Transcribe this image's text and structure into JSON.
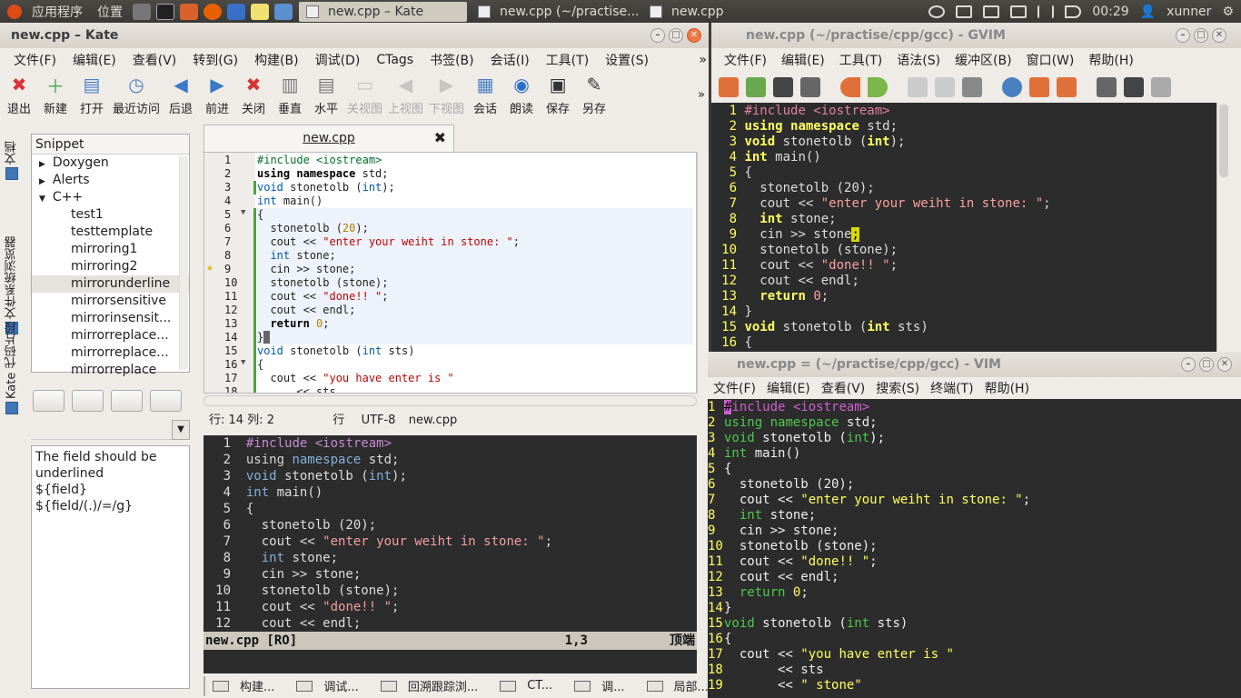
{
  "panel": {
    "apps_menu": "应用程序",
    "places_menu": "位置",
    "tasks": [
      {
        "label": "new.cpp – Kate",
        "active": true
      },
      {
        "label": "new.cpp (~/practise...",
        "active": false
      },
      {
        "label": "new.cpp",
        "active": false
      }
    ],
    "clock": "00:29",
    "user": "xunner"
  },
  "kate": {
    "title": "new.cpp – Kate",
    "menu": [
      "文件(F)",
      "编辑(E)",
      "查看(V)",
      "转到(G)",
      "构建(B)",
      "调试(D)",
      "CTags",
      "书签(B)",
      "会话(I)",
      "工具(T)",
      "设置(S)"
    ],
    "toolbar": [
      {
        "label": "退出",
        "icon": "quit-icon",
        "color": "#d93434",
        "glyph": "✖",
        "disabled": false
      },
      {
        "label": "新建",
        "icon": "new-file-icon",
        "color": "#4aa64a",
        "glyph": "＋",
        "disabled": false
      },
      {
        "label": "打开",
        "icon": "open-icon",
        "color": "#4a7fc2",
        "glyph": "▤",
        "disabled": false
      },
      {
        "label": "最近访问",
        "icon": "recent-icon",
        "color": "#4a7fc2",
        "glyph": "◷",
        "disabled": false
      },
      {
        "label": "后退",
        "icon": "back-icon",
        "color": "#3a78c8",
        "glyph": "◀",
        "disabled": false
      },
      {
        "label": "前进",
        "icon": "forward-icon",
        "color": "#3a78c8",
        "glyph": "▶",
        "disabled": false
      },
      {
        "label": "关闭",
        "icon": "close-icon",
        "color": "#d93434",
        "glyph": "✖",
        "disabled": false
      },
      {
        "label": "垂直",
        "icon": "split-vertical-icon",
        "color": "#777",
        "glyph": "▥",
        "disabled": false
      },
      {
        "label": "水平",
        "icon": "split-horizontal-icon",
        "color": "#777",
        "glyph": "▤",
        "disabled": false
      },
      {
        "label": "关视图",
        "icon": "close-view-icon",
        "color": "#999",
        "glyph": "▭",
        "disabled": true
      },
      {
        "label": "上视图",
        "icon": "prev-view-icon",
        "color": "#999",
        "glyph": "◀",
        "disabled": true
      },
      {
        "label": "下视图",
        "icon": "next-view-icon",
        "color": "#999",
        "glyph": "▶",
        "disabled": true
      },
      {
        "label": "会话",
        "icon": "session-icon",
        "color": "#4a7fc2",
        "glyph": "▦",
        "disabled": false
      },
      {
        "label": "朗读",
        "icon": "speak-icon",
        "color": "#2a6fc9",
        "glyph": "◉",
        "disabled": false
      },
      {
        "label": "保存",
        "icon": "save-icon",
        "color": "#333",
        "glyph": "▣",
        "disabled": false
      },
      {
        "label": "另存",
        "icon": "save-as-icon",
        "color": "#333",
        "glyph": "✎",
        "disabled": false
      }
    ],
    "side_tabs": [
      "文档",
      "文件系统浏览器",
      "Kate 代码片段"
    ],
    "snippet": {
      "header": "Snippet",
      "tree": [
        {
          "label": "Doxygen",
          "level": 0,
          "arrow": "▶"
        },
        {
          "label": "Alerts",
          "level": 0,
          "arrow": "▶"
        },
        {
          "label": "C++",
          "level": 0,
          "arrow": "▼"
        },
        {
          "label": "test1",
          "level": 1,
          "arrow": ""
        },
        {
          "label": "testtemplate",
          "level": 1,
          "arrow": ""
        },
        {
          "label": "mirroring1",
          "level": 1,
          "arrow": ""
        },
        {
          "label": "mirroring2",
          "level": 1,
          "arrow": ""
        },
        {
          "label": "mirrorunderline",
          "level": 1,
          "arrow": "",
          "selected": true
        },
        {
          "label": "mirrorsensitive",
          "level": 1,
          "arrow": ""
        },
        {
          "label": "mirrorinsensit...",
          "level": 1,
          "arrow": ""
        },
        {
          "label": "mirrorreplace...",
          "level": 1,
          "arrow": ""
        },
        {
          "label": "mirrorreplace...",
          "level": 1,
          "arrow": ""
        },
        {
          "label": "mirrorreplace",
          "level": 1,
          "arrow": ""
        }
      ],
      "description": [
        "The field should be underlined",
        "${field}",
        "${field/(.)/=/g}"
      ]
    },
    "tab_label": "new.cpp",
    "editor_lines": [
      [
        {
          "t": "#include <iostream>",
          "k": "pp"
        }
      ],
      [
        {
          "t": "using namespace",
          "k": "kw"
        },
        {
          "t": " std;"
        }
      ],
      [
        {
          "t": "void",
          "k": "ty"
        },
        {
          "t": " stonetolb ("
        },
        {
          "t": "int",
          "k": "ty"
        },
        {
          "t": ");"
        }
      ],
      [
        {
          "t": "int",
          "k": "ty"
        },
        {
          "t": " main()"
        }
      ],
      [
        {
          "t": "{"
        }
      ],
      [
        {
          "t": "  stonetolb ("
        },
        {
          "t": "20",
          "k": "nu"
        },
        {
          "t": ");"
        }
      ],
      [
        {
          "t": "  cout << "
        },
        {
          "t": "\"enter your weiht in stone: \"",
          "k": "st"
        },
        {
          "t": ";"
        }
      ],
      [
        {
          "t": "  "
        },
        {
          "t": "int",
          "k": "ty"
        },
        {
          "t": " stone;"
        }
      ],
      [
        {
          "t": "  cin >> stone;"
        }
      ],
      [
        {
          "t": "  stonetolb (stone);"
        }
      ],
      [
        {
          "t": "  cout << "
        },
        {
          "t": "\"done!! \"",
          "k": "st"
        },
        {
          "t": ";"
        }
      ],
      [
        {
          "t": "  cout << endl;"
        }
      ],
      [
        {
          "t": "  "
        },
        {
          "t": "return",
          "k": "kw"
        },
        {
          "t": " "
        },
        {
          "t": "0",
          "k": "nu"
        },
        {
          "t": ";"
        }
      ],
      [
        {
          "t": "}"
        }
      ],
      [
        {
          "t": "void",
          "k": "ty"
        },
        {
          "t": " stonetolb ("
        },
        {
          "t": "int",
          "k": "ty"
        },
        {
          "t": " sts)"
        }
      ],
      [
        {
          "t": "{"
        }
      ],
      [
        {
          "t": "  cout << "
        },
        {
          "t": "\"you have enter is \"",
          "k": "st"
        }
      ],
      [
        {
          "t": "      << sts"
        }
      ]
    ],
    "status": {
      "position": "行: 14 列: 2",
      "mode": "行",
      "encoding": "UTF-8",
      "filename": "new.cpp"
    },
    "vim_lines": [
      [
        {
          "t": "#i",
          "k": "pp"
        },
        {
          "t": "n",
          "k": "pp"
        },
        {
          "t": "clude <iostream>",
          "k": "pp"
        }
      ],
      [
        {
          "t": "using",
          "k": "kw"
        },
        {
          "t": " "
        },
        {
          "t": "namespace",
          "k": "ty"
        },
        {
          "t": " std;"
        }
      ],
      [
        {
          "t": "void",
          "k": "ty"
        },
        {
          "t": " stonetolb ("
        },
        {
          "t": "int",
          "k": "ty"
        },
        {
          "t": ");"
        }
      ],
      [
        {
          "t": "int",
          "k": "ty"
        },
        {
          "t": " main()"
        }
      ],
      [
        {
          "t": "{"
        }
      ],
      [
        {
          "t": "  stonetolb (20);"
        }
      ],
      [
        {
          "t": "  cout << "
        },
        {
          "t": "\"enter your weiht in stone: \"",
          "k": "st"
        },
        {
          "t": ";"
        }
      ],
      [
        {
          "t": "  "
        },
        {
          "t": "int",
          "k": "ty"
        },
        {
          "t": " stone;"
        }
      ],
      [
        {
          "t": "  cin >> stone;"
        }
      ],
      [
        {
          "t": "  stonetolb (stone);"
        }
      ],
      [
        {
          "t": "  cout << "
        },
        {
          "t": "\"done!! \"",
          "k": "st"
        },
        {
          "t": ";"
        }
      ],
      [
        {
          "t": "  cout << endl;"
        }
      ]
    ],
    "vim_status": {
      "file": "new.cpp [RO]",
      "pos": "1,3",
      "where": "顶端"
    },
    "bottom_tabs": [
      "构建...",
      "调试...",
      "回溯跟踪浏...",
      "CT...",
      "调...",
      "局部..."
    ]
  },
  "gvim": {
    "title": "new.cpp (~/practise/cpp/gcc) - GVIM",
    "menu": [
      "文件(F)",
      "编辑(E)",
      "工具(T)",
      "语法(S)",
      "缓冲区(B)",
      "窗口(W)",
      "帮助(H)"
    ],
    "lines": [
      [
        {
          "t": "#include <iostream>",
          "k": "pp"
        }
      ],
      [
        {
          "t": "using namespace",
          "k": "kw"
        },
        {
          "t": " std;"
        }
      ],
      [
        {
          "t": "void",
          "k": "ty"
        },
        {
          "t": " stonetolb ("
        },
        {
          "t": "int",
          "k": "ty"
        },
        {
          "t": ");"
        }
      ],
      [
        {
          "t": "int",
          "k": "ty"
        },
        {
          "t": " main()"
        }
      ],
      [
        {
          "t": "{"
        }
      ],
      [
        {
          "t": "  stonetolb (20);"
        }
      ],
      [
        {
          "t": "  cout << "
        },
        {
          "t": "\"enter your weiht in stone: \"",
          "k": "st"
        },
        {
          "t": ";"
        }
      ],
      [
        {
          "t": "  "
        },
        {
          "t": "int",
          "k": "ty"
        },
        {
          "t": " stone;"
        }
      ],
      [
        {
          "t": "  cin >> stone"
        },
        {
          "t": ";",
          "k": "cur"
        }
      ],
      [
        {
          "t": "  stonetolb (stone);"
        }
      ],
      [
        {
          "t": "  cout << "
        },
        {
          "t": "\"done!! \"",
          "k": "st"
        },
        {
          "t": ";"
        }
      ],
      [
        {
          "t": "  cout << endl;"
        }
      ],
      [
        {
          "t": "  "
        },
        {
          "t": "return",
          "k": "kw"
        },
        {
          "t": " "
        },
        {
          "t": "0",
          "k": "nu"
        },
        {
          "t": ";"
        }
      ],
      [
        {
          "t": "}"
        }
      ],
      [
        {
          "t": "void",
          "k": "ty"
        },
        {
          "t": " stonetolb ("
        },
        {
          "t": "int",
          "k": "ty"
        },
        {
          "t": " sts)"
        }
      ],
      [
        {
          "t": "{"
        }
      ]
    ]
  },
  "vim": {
    "title": "new.cpp = (~/practise/cpp/gcc) - VIM",
    "menu": [
      "文件(F)",
      "编辑(E)",
      "查看(V)",
      "搜索(S)",
      "终端(T)",
      "帮助(H)"
    ],
    "lines": [
      [
        {
          "t": "#",
          "k": "cur"
        },
        {
          "t": "include <iostream>",
          "k": "pp"
        }
      ],
      [
        {
          "t": "using",
          "k": "ty"
        },
        {
          "t": " "
        },
        {
          "t": "namespace",
          "k": "ty"
        },
        {
          "t": " std;"
        }
      ],
      [
        {
          "t": "void",
          "k": "ty"
        },
        {
          "t": " stonetolb ("
        },
        {
          "t": "int",
          "k": "ty"
        },
        {
          "t": ");"
        }
      ],
      [
        {
          "t": "int",
          "k": "ty"
        },
        {
          "t": " main()"
        }
      ],
      [
        {
          "t": "{"
        }
      ],
      [
        {
          "t": "  stonetolb (20);"
        }
      ],
      [
        {
          "t": "  cout << "
        },
        {
          "t": "\"enter your weiht in stone: \"",
          "k": "st"
        },
        {
          "t": ";"
        }
      ],
      [
        {
          "t": "  "
        },
        {
          "t": "int",
          "k": "ty"
        },
        {
          "t": " stone;"
        }
      ],
      [
        {
          "t": "  cin >> stone;"
        }
      ],
      [
        {
          "t": "  stonetolb (stone);"
        }
      ],
      [
        {
          "t": "  cout << "
        },
        {
          "t": "\"done!! \"",
          "k": "st"
        },
        {
          "t": ";"
        }
      ],
      [
        {
          "t": "  cout << endl;"
        }
      ],
      [
        {
          "t": "  "
        },
        {
          "t": "return",
          "k": "ty"
        },
        {
          "t": " "
        },
        {
          "t": "0",
          "k": "nu"
        },
        {
          "t": ";"
        }
      ],
      [
        {
          "t": "}"
        }
      ],
      [
        {
          "t": "void",
          "k": "ty"
        },
        {
          "t": " stonetolb ("
        },
        {
          "t": "int",
          "k": "ty"
        },
        {
          "t": " sts)"
        }
      ],
      [
        {
          "t": "{"
        }
      ],
      [
        {
          "t": "  cout << "
        },
        {
          "t": "\"you have enter is \"",
          "k": "st"
        }
      ],
      [
        {
          "t": "       << sts"
        }
      ],
      [
        {
          "t": "       << "
        },
        {
          "t": "\" stone\"",
          "k": "st"
        }
      ]
    ]
  }
}
